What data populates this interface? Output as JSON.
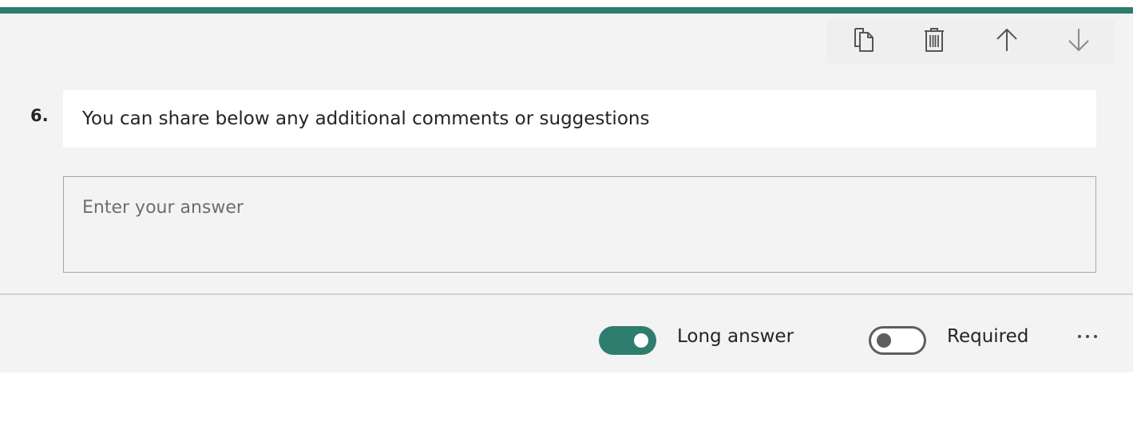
{
  "question": {
    "number": "6.",
    "title": "You can share below any additional comments or suggestions",
    "answer_placeholder": "Enter your answer"
  },
  "toolbar": {
    "icons": [
      "copy-icon",
      "delete-icon",
      "move-up-icon",
      "move-down-icon"
    ]
  },
  "options": {
    "long_answer_label": "Long answer",
    "long_answer_on": true,
    "required_label": "Required",
    "required_on": false,
    "more_icon": "more-options-icon"
  },
  "colors": {
    "accent": "#2f7d6e",
    "card_background": "#f3f3f3"
  }
}
